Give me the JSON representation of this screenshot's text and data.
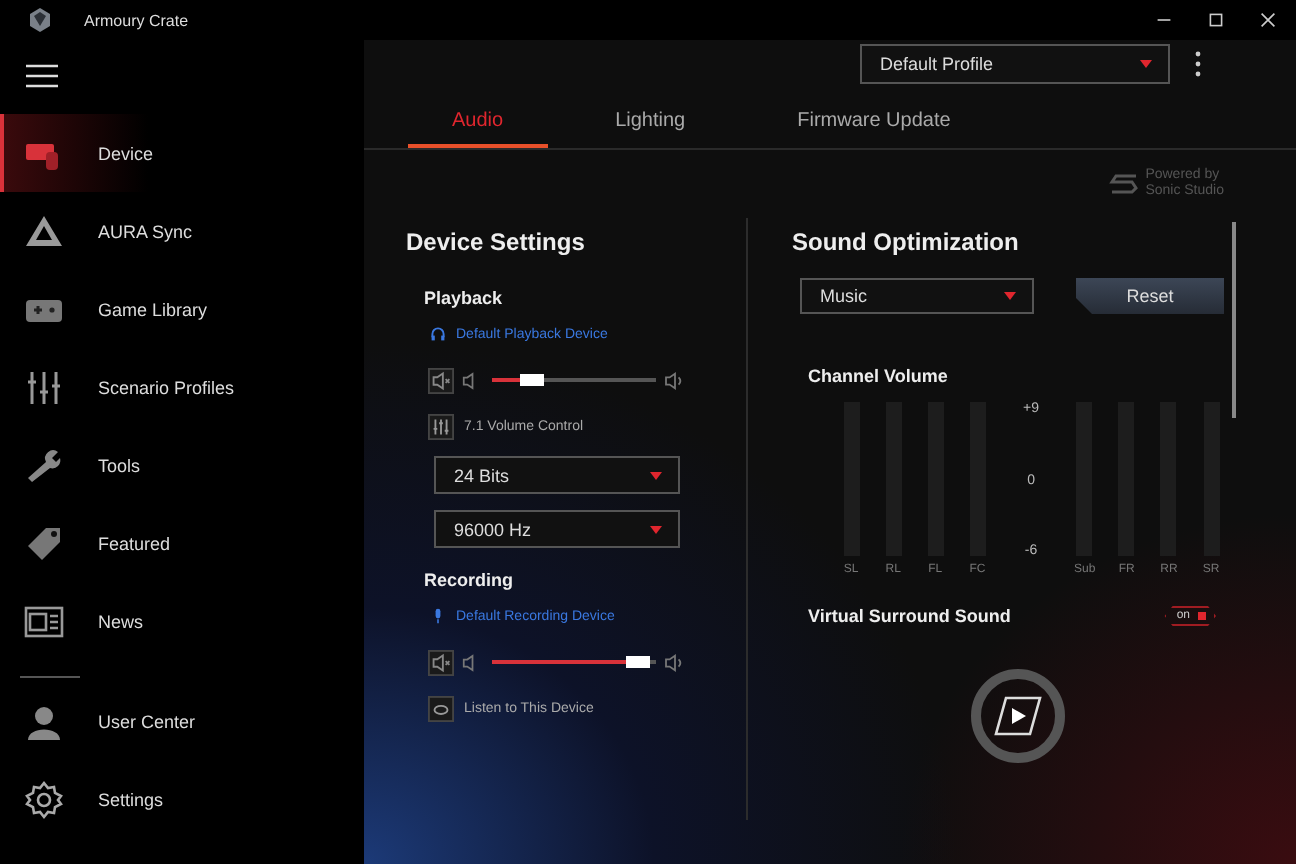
{
  "window": {
    "title": "Armoury Crate"
  },
  "sidebar": {
    "items": [
      {
        "label": "Device",
        "selected": true
      },
      {
        "label": "AURA Sync",
        "selected": false
      },
      {
        "label": "Game Library",
        "selected": false
      },
      {
        "label": "Scenario Profiles",
        "selected": false
      },
      {
        "label": "Tools",
        "selected": false
      },
      {
        "label": "Featured",
        "selected": false
      },
      {
        "label": "News",
        "selected": false
      }
    ],
    "bottom_items": [
      {
        "label": "User Center",
        "selected": false
      },
      {
        "label": "Settings",
        "selected": false
      }
    ]
  },
  "profile": {
    "value": "Default Profile"
  },
  "tabs": [
    {
      "label": "Audio",
      "selected": true
    },
    {
      "label": "Lighting",
      "selected": false
    },
    {
      "label": "Firmware Update",
      "selected": false
    }
  ],
  "powered_by": [
    "Powered by",
    "Sonic Studio"
  ],
  "device_settings": {
    "title": "Device Settings",
    "playback": {
      "title": "Playback",
      "device": "Default Playback Device",
      "level": 0.2,
      "volume_control": "7.1 Volume Control",
      "bits": "24 Bits",
      "rate": "96000 Hz"
    },
    "recording": {
      "title": "Recording",
      "device": "Default Recording Device",
      "level": 0.95,
      "listen": "Listen to This Device"
    }
  },
  "sound_optimization": {
    "title": "Sound Optimization",
    "preset": "Music",
    "reset": "Reset",
    "channel_volume": {
      "title": "Channel Volume",
      "scale": [
        "+9",
        "0",
        "-6"
      ],
      "channels": [
        "SL",
        "RL",
        "FL",
        "FC",
        "Sub",
        "FR",
        "RR",
        "SR"
      ]
    },
    "virtual_surround": {
      "title": "Virtual Surround Sound",
      "toggle_label": "on",
      "on": true
    }
  }
}
